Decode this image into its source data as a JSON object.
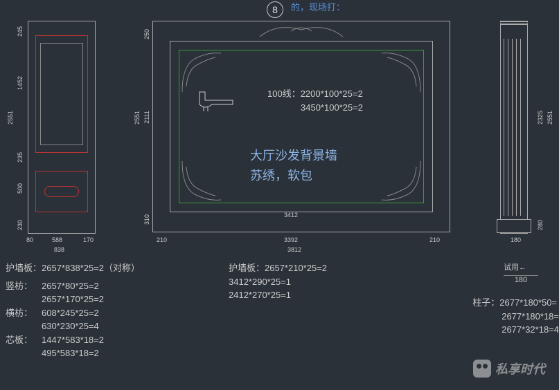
{
  "header": {
    "circle_number": "8",
    "top_fragment": "的，现场打："
  },
  "center": {
    "line100_label": "100线：",
    "line100_a": "2200*100*25=2",
    "line100_b": "3450*100*25=2",
    "title_a": "大厅沙发背景墙",
    "title_b": "苏绣，软包"
  },
  "dims": {
    "left_heights": {
      "a": "245",
      "b": "1452",
      "c": "235",
      "d": "500",
      "e": "230",
      "total": "2551"
    },
    "left_widths": {
      "a": "80",
      "b": "588",
      "c": "170",
      "total": "838"
    },
    "center_heights": {
      "a": "250",
      "b": "2111",
      "c": "310",
      "total": "2551",
      "alt": "2551"
    },
    "center_widths": {
      "a": "210",
      "b": "3392",
      "c": "210",
      "inner": "3412",
      "total": "3812"
    },
    "right": {
      "total": "2551",
      "alt": "2325",
      "cap": "280",
      "w": "180",
      "w2": "180"
    }
  },
  "specs_left": {
    "huqiangban_label": "护墙板：",
    "huqiangban_val": "2657*838*25=2（对称）",
    "shufang_label": "竖枋：",
    "shufang_a": "2657*80*25=2",
    "shufang_b": "2657*170*25=2",
    "hengfang_label": "横枋：",
    "hengfang_a": "608*245*25=2",
    "hengfang_b": "630*230*25=4",
    "xinban_label": "芯板：",
    "xinban_a": "1447*583*18=2",
    "xinban_b": "495*583*18=2"
  },
  "specs_center": {
    "huqiangban_label": "护墙板：",
    "a": "2657*210*25=2",
    "b": "3412*290*25=1",
    "c": "2412*270*25=1"
  },
  "specs_right": {
    "zhuzi_label": "柱子：",
    "a": "2677*180*50=",
    "b": "2677*180*18=",
    "c": "2677*32*18=4"
  },
  "trial": {
    "label": "试用←",
    "val": "180"
  },
  "watermark": "私享时代"
}
